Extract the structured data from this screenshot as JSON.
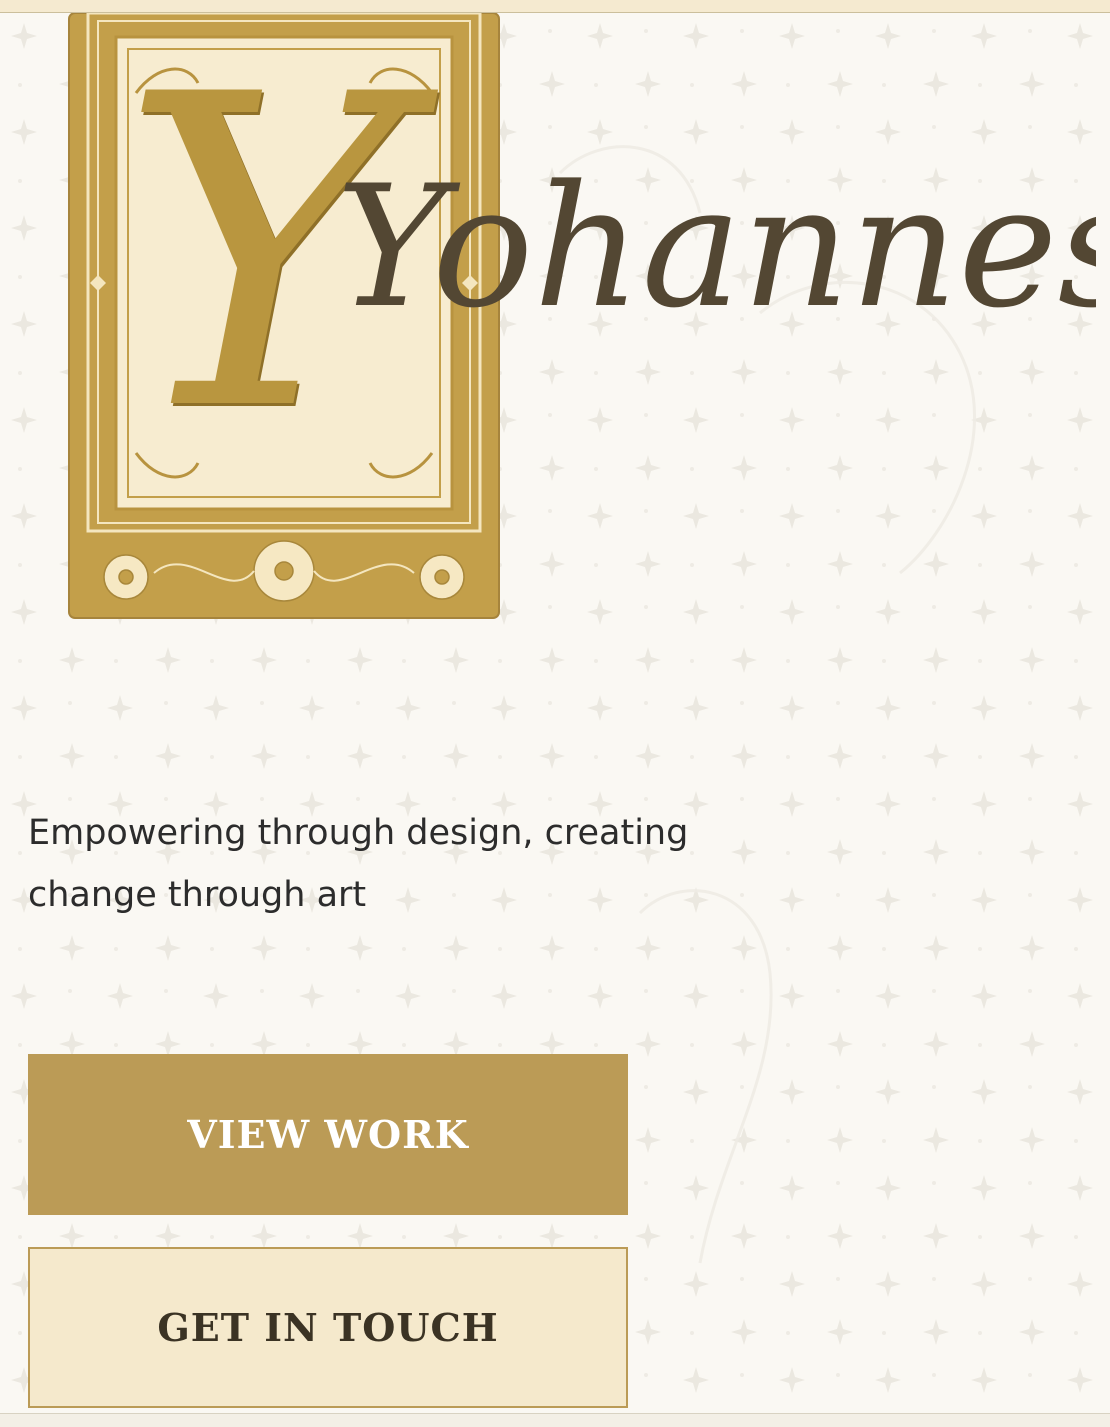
{
  "hero": {
    "monogram": "Y",
    "name": "Yohannes",
    "tagline_line1": "Empowering through design, creating",
    "tagline_line2": "change through art"
  },
  "actions": {
    "primary_label": "VIEW WORK",
    "secondary_label": "GET IN TOUCH"
  },
  "colors": {
    "gold": "#bb9b56",
    "gold_dark": "#b9963f",
    "cream": "#f5e9cc",
    "ink": "#534733",
    "text": "#2c2c2c",
    "background": "#faf8f3"
  }
}
